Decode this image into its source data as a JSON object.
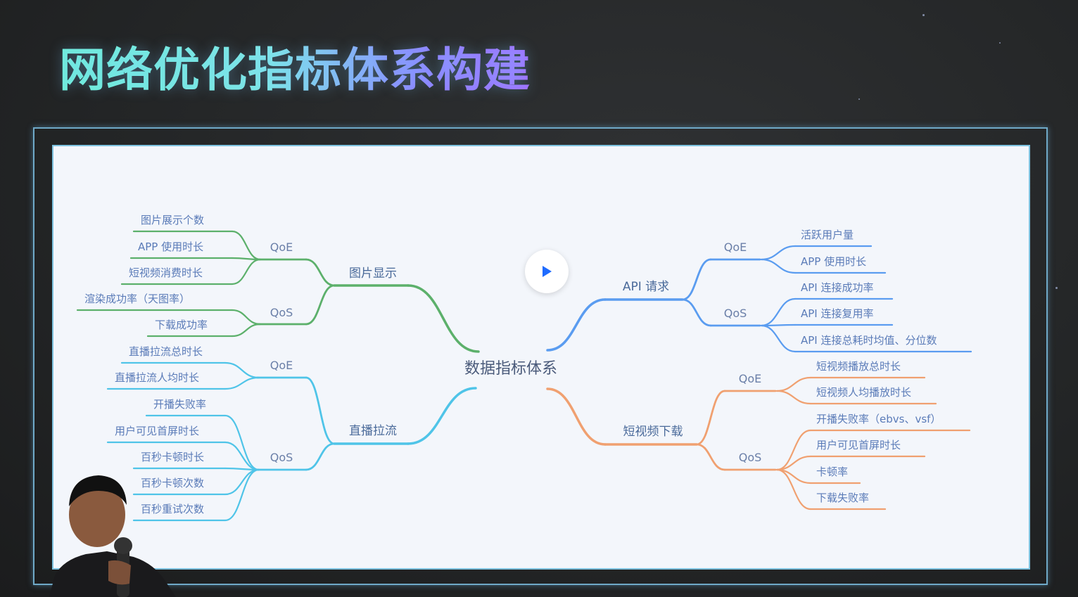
{
  "slide": {
    "title": "网络优化指标体系构建"
  },
  "mindmap": {
    "center": "数据指标体系",
    "branches": [
      {
        "label": "图片显示",
        "color": "#5cb06b",
        "groups": [
          {
            "label": "QoE",
            "items": [
              "图片展示个数",
              "APP 使用时长",
              "短视频消费时长"
            ]
          },
          {
            "label": "QoS",
            "items": [
              "渲染成功率（天图率）",
              "下载成功率"
            ]
          }
        ]
      },
      {
        "label": "直播拉流",
        "color": "#4fc4e8",
        "groups": [
          {
            "label": "QoE",
            "items": [
              "直播拉流总时长",
              "直播拉流人均时长"
            ]
          },
          {
            "label": "QoS",
            "items": [
              "开播失败率",
              "用户可见首屏时长",
              "百秒卡顿时长",
              "百秒卡顿次数",
              "百秒重试次数"
            ]
          }
        ]
      },
      {
        "label": "API 请求",
        "color": "#5a9cf0",
        "groups": [
          {
            "label": "QoE",
            "items": [
              "活跃用户量",
              "APP 使用时长"
            ]
          },
          {
            "label": "QoS",
            "items": [
              "API 连接成功率",
              "API 连接复用率",
              "API 连接总耗时均值、分位数"
            ]
          }
        ]
      },
      {
        "label": "短视频下载",
        "color": "#f0a070",
        "groups": [
          {
            "label": "QoE",
            "items": [
              "短视频播放总时长",
              "短视频人均播放时长"
            ]
          },
          {
            "label": "QoS",
            "items": [
              "开播失败率（ebvs、vsf）",
              "用户可见首屏时长",
              "卡顿率",
              "下载失败率"
            ]
          }
        ]
      }
    ]
  },
  "player": {
    "play_icon": "play-icon",
    "accent": "#1e6bff"
  }
}
